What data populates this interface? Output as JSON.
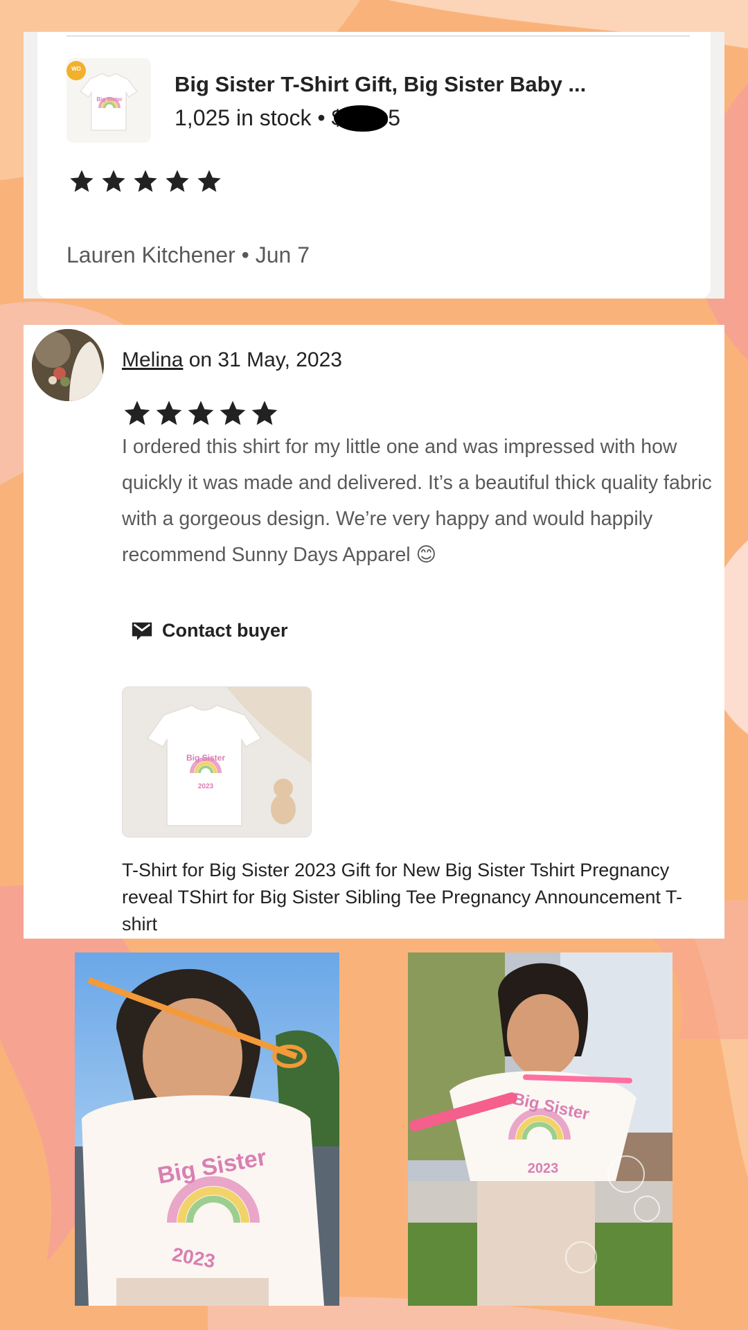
{
  "product": {
    "title": "Big Sister T-Shirt Gift, Big Sister Baby ...",
    "stock": "1,025 in stock • $",
    "price_tail": "5",
    "thumb_alt": "Big Sister shirt thumbnail"
  },
  "rating_card": {
    "stars": 5,
    "reviewer_line": "Lauren Kitchener • Jun 7"
  },
  "review": {
    "name": "Melina",
    "date_text": " on 31 May, 2023",
    "stars": 5,
    "body": "I ordered this shirt for my little one and was impressed with how quickly it was made and delivered. It’s a beautiful thick quality fabric with a gorgeous design. We’re very happy and would happily recommend Sunny Days Apparel 😊",
    "contact_label": "Contact buyer",
    "listing_title": "T-Shirt for Big Sister 2023 Gift for New Big Sister Tshirt Pregnancy reveal TShirt for Big Sister Sibling Tee Pregnancy Announcement T-shirt"
  },
  "shirt_print": {
    "line1": "Big Sister",
    "year": "2023",
    "small_year": "2023"
  },
  "colors": {
    "background_orange": "#f9b37a",
    "background_pink": "#f6a392",
    "star": "#222222",
    "text_dark": "#222222",
    "text_grey": "#595959"
  }
}
